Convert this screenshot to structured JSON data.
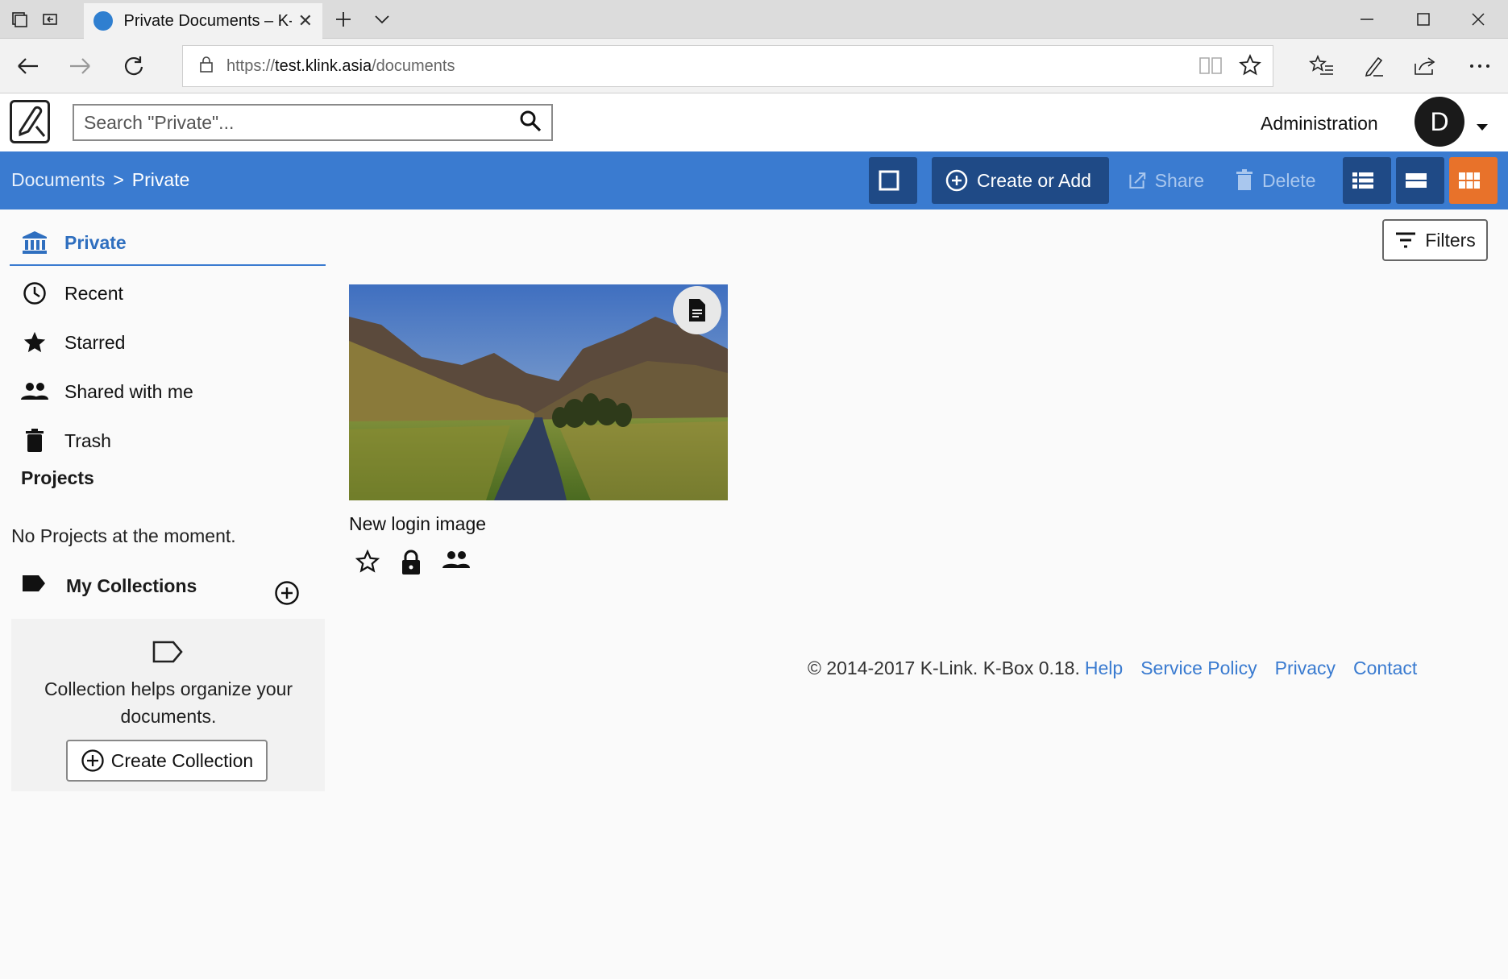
{
  "browser": {
    "tab_title": "Private Documents – K-",
    "url_prefix": "https://",
    "url_host": "test.klink.asia",
    "url_path": "/documents"
  },
  "header": {
    "search_placeholder": "Search \"Private\"...",
    "admin_label": "Administration",
    "avatar_initial": "D"
  },
  "toolbar": {
    "breadcrumb_root": "Documents",
    "breadcrumb_sep": ">",
    "breadcrumb_current": "Private",
    "create_label": "Create or Add",
    "share_label": "Share",
    "delete_label": "Delete"
  },
  "sidebar": {
    "items": [
      {
        "label": "Private",
        "icon": "bank-icon"
      },
      {
        "label": "Recent",
        "icon": "clock-icon"
      },
      {
        "label": "Starred",
        "icon": "star-icon"
      },
      {
        "label": "Shared with me",
        "icon": "people-icon"
      },
      {
        "label": "Trash",
        "icon": "trash-icon"
      }
    ],
    "projects_title": "Projects",
    "no_projects": "No Projects at the moment.",
    "collections_title": "My Collections",
    "collections_help": "Collection helps organize your documents.",
    "create_collection": "Create Collection"
  },
  "main": {
    "filters_label": "Filters",
    "document": {
      "title": "New login image"
    }
  },
  "footer": {
    "copyright": "© 2014-2017 K-Link. K-Box 0.18.",
    "links": [
      "Help",
      "Service Policy",
      "Privacy",
      "Contact"
    ]
  },
  "colors": {
    "accent": "#3a7bd0",
    "toolbar_dark": "#1f4a86",
    "grid_active": "#e8722a"
  }
}
